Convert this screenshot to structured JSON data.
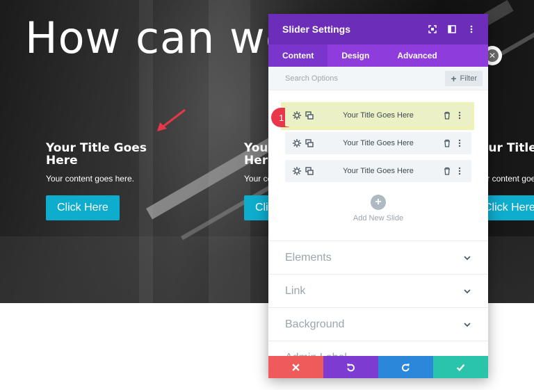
{
  "hero": {
    "title": "How can we",
    "slides": [
      {
        "title": "Your Title Goes Here",
        "content": "Your content goes here.",
        "button": "Click Here"
      },
      {
        "title": "Your Title Goes Here",
        "content": "Your content goes here.",
        "button": "Click Here"
      },
      {
        "title": "Your Title Goes",
        "content": "Your content goes here.",
        "button": "Click Here"
      }
    ]
  },
  "panel": {
    "title": "Slider Settings",
    "tabs": [
      "Content",
      "Design",
      "Advanced"
    ],
    "active_tab": "Content",
    "search_placeholder": "Search Options",
    "filter_label": "Filter",
    "slides": [
      "Your Title Goes Here",
      "Your Title Goes Here",
      "Your Title Goes Here"
    ],
    "step_badge": "1",
    "add_slide_label": "Add New Slide",
    "sections": [
      "Elements",
      "Link",
      "Background",
      "Admin Label"
    ]
  },
  "colors": {
    "header": "#6c2eb9",
    "tabs": "#8e3ddc",
    "cancel": "#ef5a5a",
    "undo": "#7d3bd1",
    "redo": "#2b87da",
    "save": "#29c4a9",
    "button": "#0eaccd",
    "badge": "#e8364a"
  },
  "icons": {
    "header": [
      "fullscreen-icon",
      "split-view-icon",
      "more-vertical-icon"
    ],
    "row": [
      "gear-icon",
      "duplicate-icon",
      "trash-icon",
      "more-vertical-icon"
    ],
    "footer": [
      "close-icon",
      "undo-icon",
      "redo-icon",
      "check-icon"
    ]
  }
}
